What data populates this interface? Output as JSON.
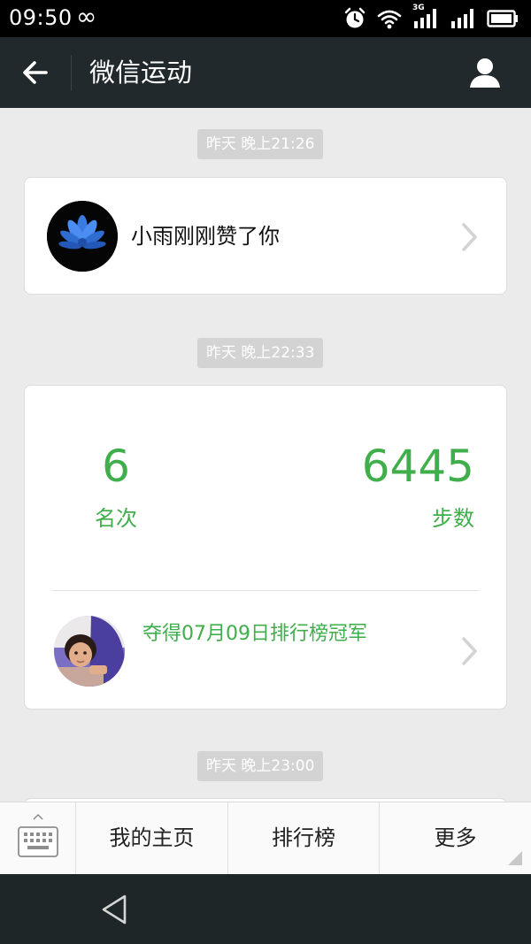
{
  "status_bar": {
    "time": "09:50",
    "link_glyph": "∞",
    "network_label": "3G",
    "icons": [
      "alarm-icon",
      "wifi-icon",
      "signal-3g-icon",
      "signal-icon",
      "battery-icon"
    ]
  },
  "header": {
    "title": "微信运动",
    "back_icon": "arrow-left-icon",
    "profile_icon": "person-icon",
    "background": "#22292c"
  },
  "feed": [
    {
      "timestamp": "昨天 晚上21:26",
      "type": "like",
      "text": "小雨刚刚赞了你",
      "avatar": "blue-lotus-avatar"
    },
    {
      "timestamp": "昨天 晚上22:33",
      "type": "ranking",
      "rank_value": "6",
      "rank_label": "名次",
      "steps_value": "6445",
      "steps_label": "步数",
      "champion_text": "夺得07月09日排行榜冠军",
      "avatar": "child-photo-avatar"
    },
    {
      "timestamp": "昨天 晚上23:00"
    }
  ],
  "bottom_menu": {
    "keyboard_icon": "keyboard-icon",
    "tabs": [
      "我的主页",
      "排行榜",
      "更多"
    ]
  },
  "colors": {
    "accent_green": "#3fae4b",
    "page_background": "#ebebeb",
    "timestamp_pill": "#d3d3d3"
  }
}
